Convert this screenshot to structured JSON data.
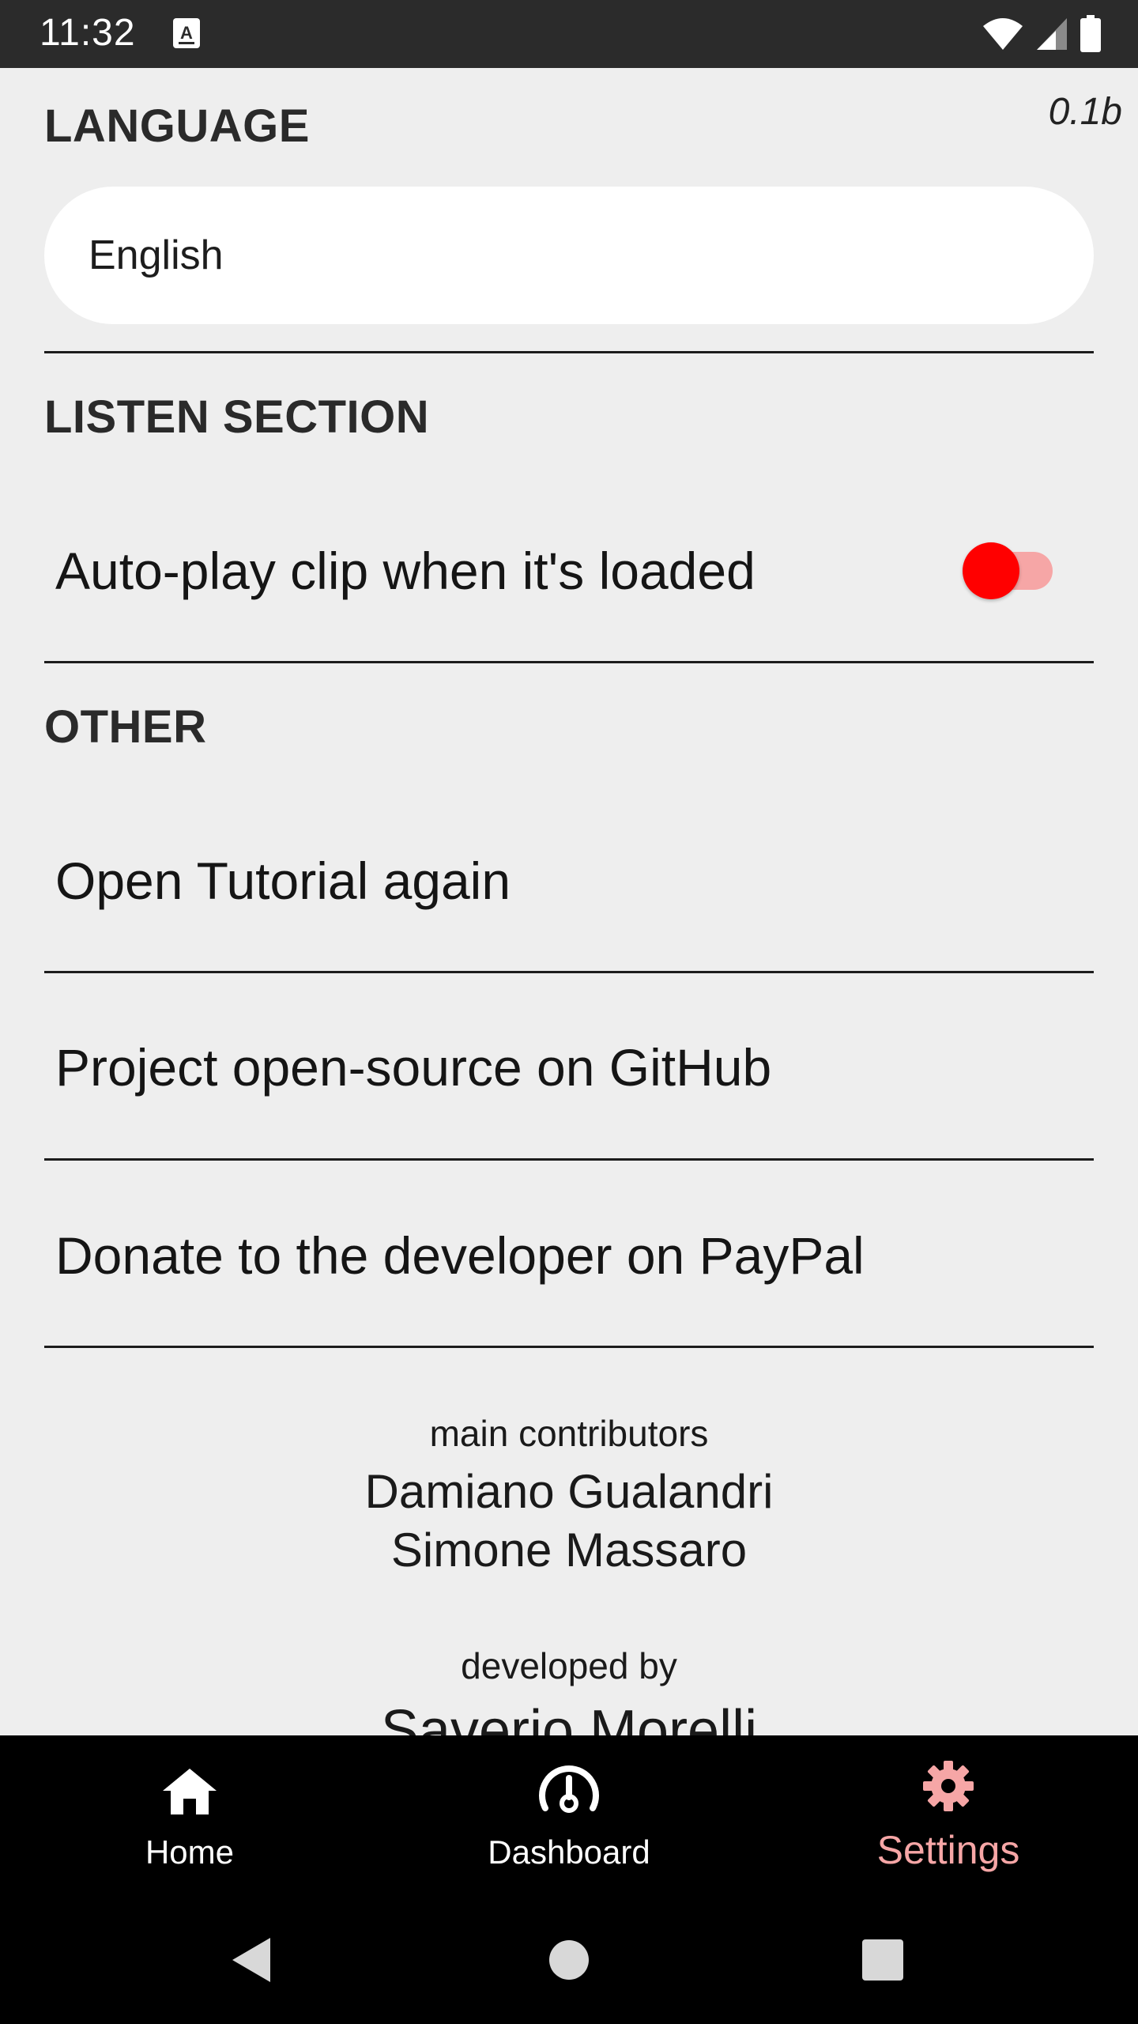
{
  "status_bar": {
    "time": "11:32",
    "icons": [
      "keyboard-a-icon",
      "wifi-icon",
      "cell-signal-icon",
      "battery-icon"
    ]
  },
  "version": "0.1b",
  "sections": {
    "language": {
      "title": "LANGUAGE",
      "selected": "English"
    },
    "listen": {
      "title": "LISTEN SECTION",
      "autoplay_label": "Auto-play clip when it's loaded",
      "autoplay_enabled": true
    },
    "other": {
      "title": "OTHER",
      "items": [
        {
          "label": "Open Tutorial again"
        },
        {
          "label": "Project open-source on GitHub"
        },
        {
          "label": "Donate to the developer on PayPal"
        }
      ]
    }
  },
  "credits": {
    "contributors_title": "main contributors",
    "contributors": [
      "Damiano Gualandri",
      "Simone Massaro"
    ],
    "developer_title": "developed by",
    "developer": "Saverio Morelli"
  },
  "bottom_nav": {
    "items": [
      {
        "label": "Home",
        "icon": "home-icon",
        "active": false
      },
      {
        "label": "Dashboard",
        "icon": "dashboard-icon",
        "active": false
      },
      {
        "label": "Settings",
        "icon": "gear-icon",
        "active": true
      }
    ],
    "active_color": "#f6a6a6"
  },
  "colors": {
    "background": "#eeeeee",
    "toggle_thumb": "#ff0000",
    "toggle_track": "#f6a6a6"
  }
}
